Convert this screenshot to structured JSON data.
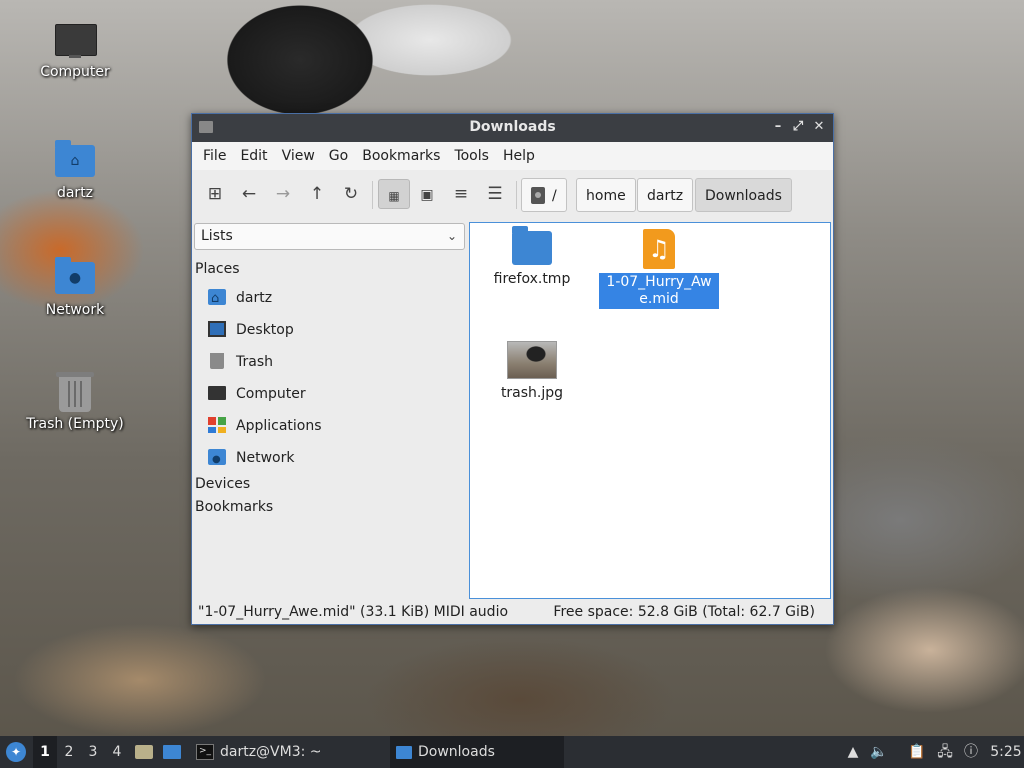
{
  "desktop": {
    "icons": [
      {
        "label": "Computer",
        "icon": "computer-icon"
      },
      {
        "label": "dartz",
        "icon": "home-folder-icon"
      },
      {
        "label": "Network",
        "icon": "network-folder-icon"
      },
      {
        "label": "Trash (Empty)",
        "icon": "trash-icon"
      }
    ]
  },
  "window": {
    "title": "Downloads",
    "controls": {
      "minimize": "–",
      "maximize": "⤢",
      "close": "✕"
    },
    "menu": [
      "File",
      "Edit",
      "View",
      "Go",
      "Bookmarks",
      "Tools",
      "Help"
    ],
    "toolbar": {
      "buttons": [
        "new-tab-icon",
        "back-icon",
        "forward-icon",
        "up-icon",
        "reload-icon",
        "icon-view-icon",
        "thumbnail-view-icon",
        "compact-view-icon",
        "detailed-list-icon"
      ],
      "active_view": "icon-view-icon"
    },
    "breadcrumb": [
      "/",
      "home",
      "dartz",
      "Downloads"
    ],
    "sidepane": {
      "mode": "Lists",
      "places_heading": "Places",
      "places": [
        "dartz",
        "Desktop",
        "Trash",
        "Computer",
        "Applications",
        "Network"
      ],
      "devices_heading": "Devices",
      "bookmarks_heading": "Bookmarks"
    },
    "files": [
      {
        "name": "firefox.tmp",
        "type": "folder",
        "selected": false
      },
      {
        "name": "1-07_Hurry_Awe.mid",
        "type": "audio",
        "selected": true
      },
      {
        "name": "trash.jpg",
        "type": "image",
        "selected": false
      }
    ],
    "status": {
      "selection": "\"1-07_Hurry_Awe.mid\" (33.1 KiB) MIDI audio",
      "space": "Free space: 52.8 GiB (Total: 62.7 GiB)"
    }
  },
  "taskbar": {
    "workspaces": [
      "1",
      "2",
      "3",
      "4"
    ],
    "current_workspace": "1",
    "tasks": [
      "dartz@VM3: ~",
      "Downloads"
    ],
    "active_task": "Downloads",
    "clock": "5:25"
  },
  "colors": {
    "accent": "#3584e4",
    "folder": "#3d86d3",
    "titlebar": "#3b3e43",
    "taskbar": "#2b2e33"
  }
}
